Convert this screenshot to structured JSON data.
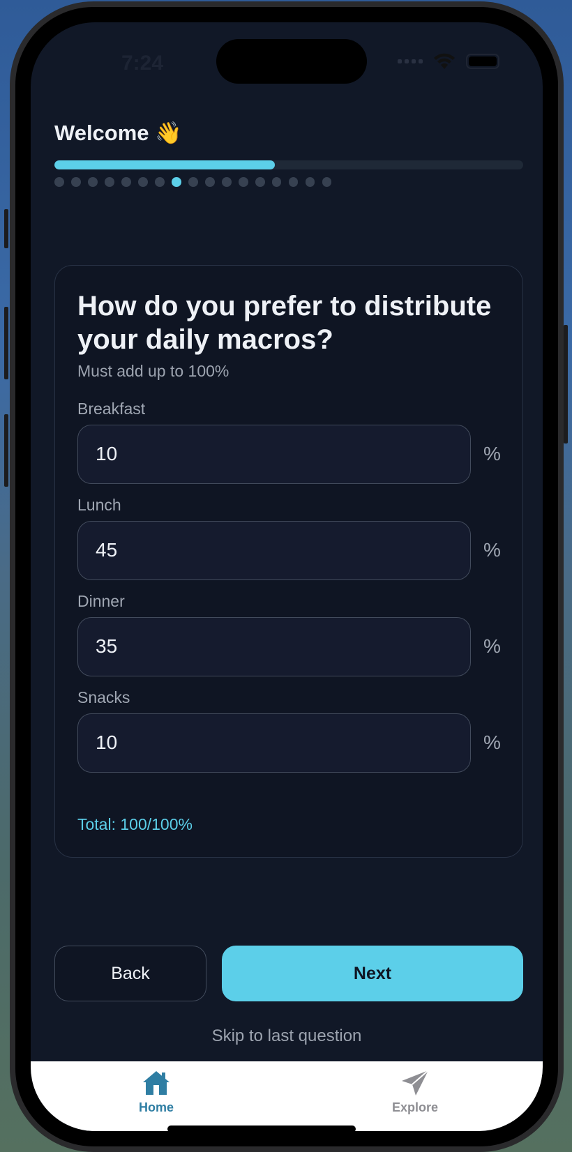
{
  "status": {
    "time": "7:24"
  },
  "header": {
    "title": "Welcome 👋",
    "progress": 0.47,
    "step_count": 17,
    "active_step": 8
  },
  "card": {
    "question": "How do you prefer to distribute your daily macros?",
    "hint": "Must add up to 100%",
    "fields": [
      {
        "label": "Breakfast",
        "value": "10",
        "unit": "%"
      },
      {
        "label": "Lunch",
        "value": "45",
        "unit": "%"
      },
      {
        "label": "Dinner",
        "value": "35",
        "unit": "%"
      },
      {
        "label": "Snacks",
        "value": "10",
        "unit": "%"
      }
    ],
    "total": "Total: 100/100%"
  },
  "actions": {
    "back_label": "Back",
    "next_label": "Next",
    "skip_label": "Skip to last question"
  },
  "tabs": {
    "home_label": "Home",
    "explore_label": "Explore"
  },
  "colors": {
    "accent": "#5ccfe9",
    "background": "#111827",
    "active_tab": "#2f7ea3",
    "inactive_tab": "#8e8e93"
  },
  "icons": {
    "home": "home-icon",
    "explore": "paper-plane-icon",
    "wifi": "wifi-icon",
    "battery": "battery-icon",
    "signal": "cellular-signal-icon"
  }
}
